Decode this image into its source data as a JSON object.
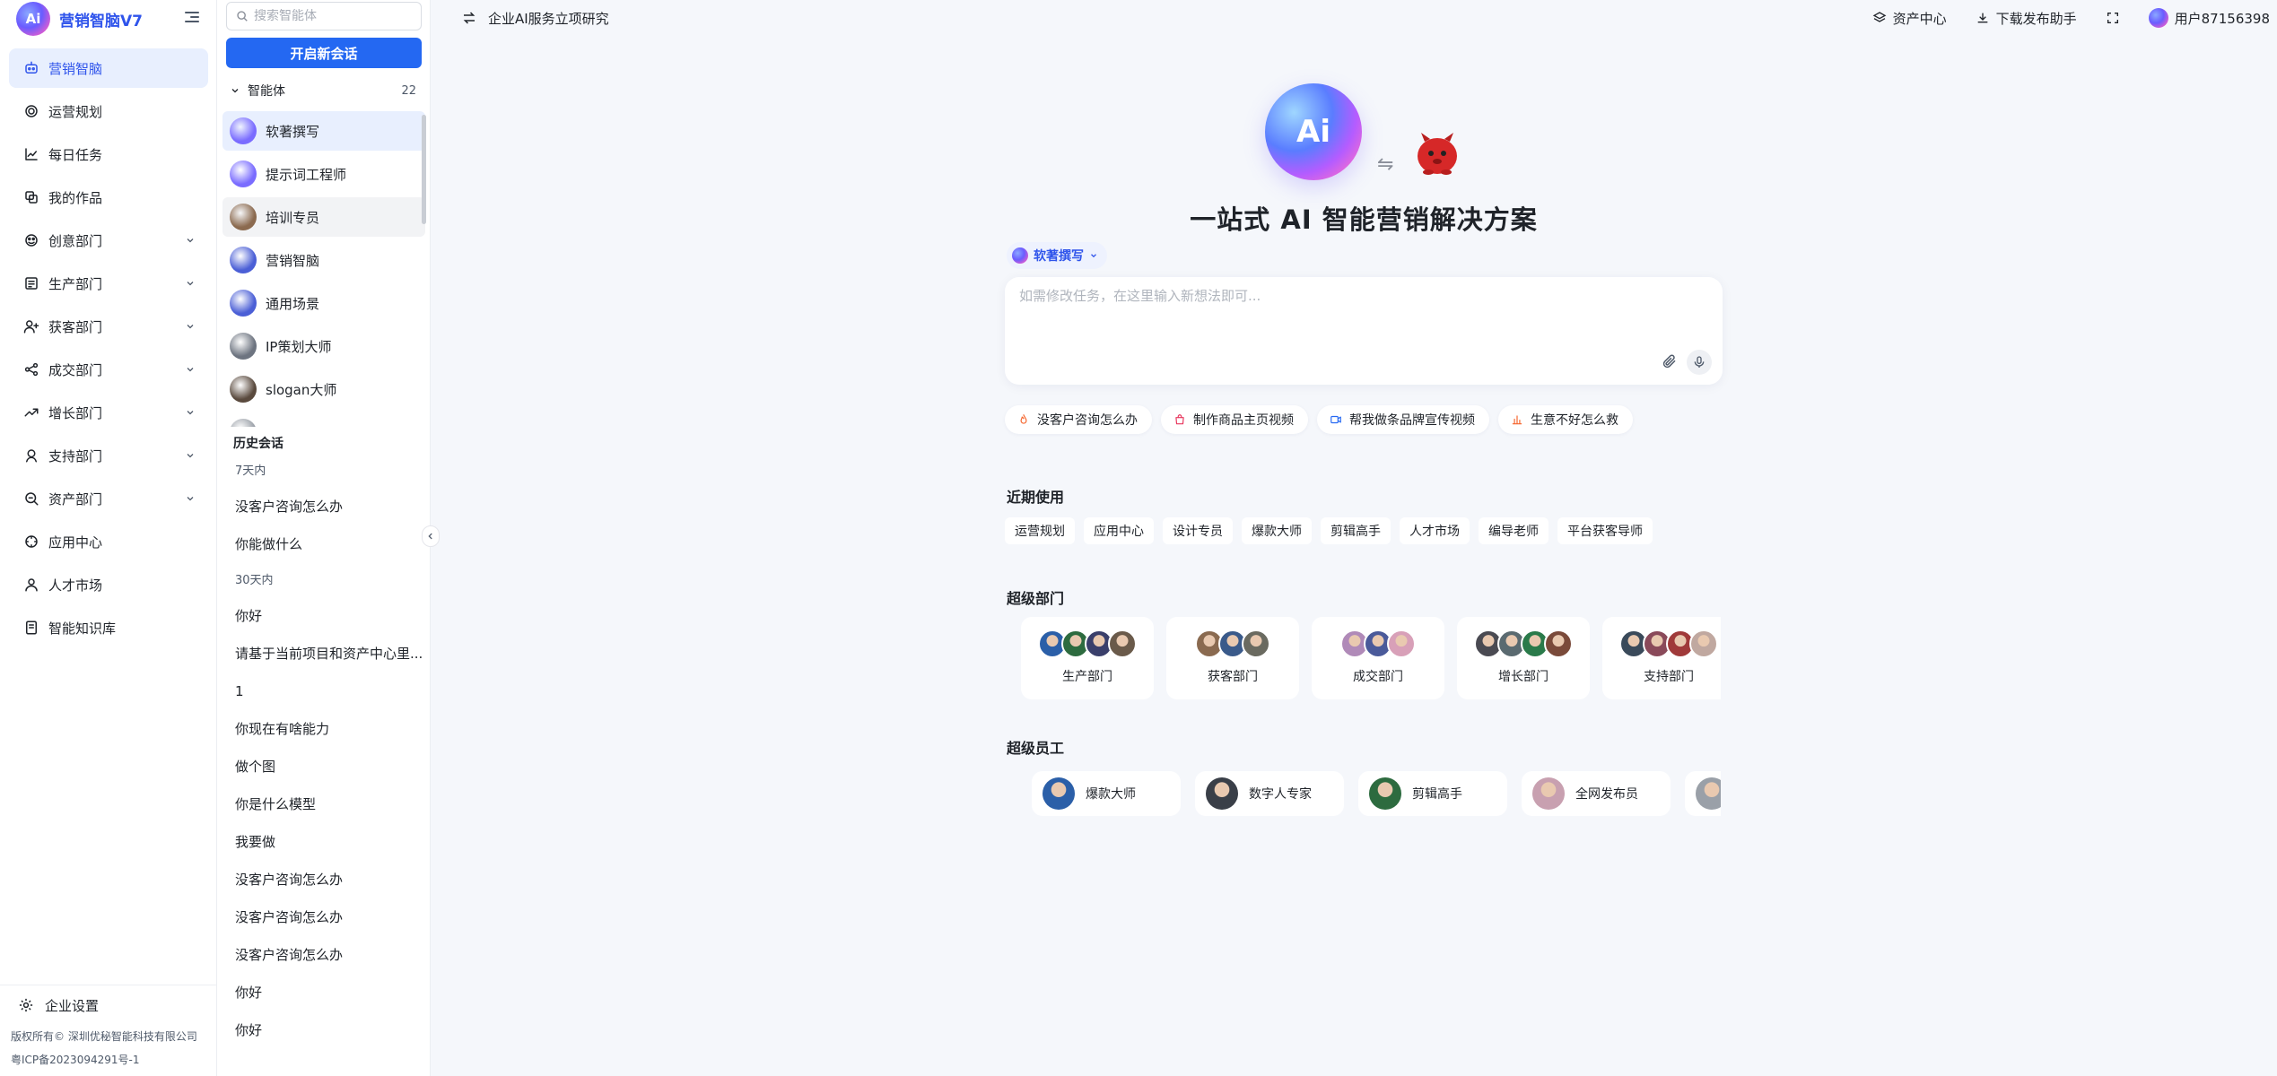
{
  "brand": {
    "name": "营销智脑V7"
  },
  "nav": {
    "items": [
      {
        "label": "营销智脑",
        "icon": "robot-icon",
        "active": true,
        "expandable": false
      },
      {
        "label": "运营规划",
        "icon": "target-icon",
        "expandable": false
      },
      {
        "label": "每日任务",
        "icon": "chart-line-icon",
        "expandable": false
      },
      {
        "label": "我的作品",
        "icon": "works-icon",
        "expandable": false
      },
      {
        "label": "创意部门",
        "icon": "palette-icon",
        "expandable": true
      },
      {
        "label": "生产部门",
        "icon": "factory-icon",
        "expandable": true
      },
      {
        "label": "获客部门",
        "icon": "user-add-icon",
        "expandable": true
      },
      {
        "label": "成交部门",
        "icon": "share-icon",
        "expandable": true
      },
      {
        "label": "增长部门",
        "icon": "trend-up-icon",
        "expandable": true
      },
      {
        "label": "支持部门",
        "icon": "support-icon",
        "expandable": true
      },
      {
        "label": "资产部门",
        "icon": "search-asset-icon",
        "expandable": true
      },
      {
        "label": "应用中心",
        "icon": "compass-icon",
        "expandable": false
      },
      {
        "label": "人才市场",
        "icon": "person-icon",
        "expandable": false
      },
      {
        "label": "智能知识库",
        "icon": "book-icon",
        "expandable": false
      }
    ],
    "settings_label": "企业设置",
    "copyright": "版权所有© 深圳优秘智能科技有限公司",
    "icp": "粤ICP备2023094291号-1"
  },
  "panel": {
    "search_placeholder": "搜索智能体",
    "new_chat_label": "开启新会话",
    "agents_label": "智能体",
    "agents_count": "22",
    "agents": [
      {
        "name": "软著撰写",
        "avatar": "#7a6cff",
        "active": true
      },
      {
        "name": "提示词工程师",
        "avatar": "#7a6cff"
      },
      {
        "name": "培训专员",
        "avatar": "#8b6a4f",
        "hover": true
      },
      {
        "name": "营销智脑",
        "avatar": "#4b5fd6"
      },
      {
        "name": "通用场景",
        "avatar": "#4b5fd6"
      },
      {
        "name": "IP策划大师",
        "avatar": "#6d7480"
      },
      {
        "name": "slogan大师",
        "avatar": "#5a4a3e"
      },
      {
        "name": "",
        "avatar": "#9aa0a8"
      }
    ],
    "history_label": "历史会话",
    "history": [
      {
        "group": "7天内",
        "items": [
          "没客户咨询怎么办",
          "你能做什么"
        ]
      },
      {
        "group": "30天内",
        "items": [
          "你好",
          "请基于当前项目和资产中心里...",
          "1",
          "你现在有啥能力",
          "做个图",
          "你是什么模型",
          "我要做",
          "没客户咨询怎么办",
          "没客户咨询怎么办",
          "没客户咨询怎么办",
          "你好",
          "你好"
        ]
      }
    ]
  },
  "topbar": {
    "project": "企业AI服务立项研究",
    "assets_label": "资产中心",
    "download_label": "下载发布助手",
    "user_label": "用户87156398"
  },
  "main": {
    "hero_logo_text": "Ai",
    "title": "一站式 AI 智能营销解决方案",
    "agent_pill": "软著撰写",
    "input_placeholder": "如需修改任务，在这里输入新想法即可...",
    "suggestions": [
      {
        "label": "没客户咨询怎么办",
        "icon": "fire-icon",
        "color": "#f5632a"
      },
      {
        "label": "制作商品主页视频",
        "icon": "bag-icon",
        "color": "#e8365d"
      },
      {
        "label": "帮我做条品牌宣传视频",
        "icon": "video-icon",
        "color": "#2468f2"
      },
      {
        "label": "生意不好怎么救",
        "icon": "bar-chart-icon",
        "color": "#f5632a"
      }
    ],
    "recent_label": "近期使用",
    "recent": [
      "运营规划",
      "应用中心",
      "设计专员",
      "爆款大师",
      "剪辑高手",
      "人才市场",
      "编导老师",
      "平台获客导师"
    ],
    "depts_label": "超级部门",
    "depts": [
      {
        "name": "生产部门",
        "faces": [
          "#2b5fa8",
          "#2d6b3f",
          "#3a3f6b",
          "#6a5a4a"
        ]
      },
      {
        "name": "获客部门",
        "faces": [
          "#8a6a50",
          "#3a5a8a",
          "#6a6a60"
        ]
      },
      {
        "name": "成交部门",
        "faces": [
          "#b08ab8",
          "#4a5a9a",
          "#d8a0b8"
        ]
      },
      {
        "name": "增长部门",
        "faces": [
          "#4a4a52",
          "#5a6a70",
          "#2a7a4a",
          "#7a4a3a"
        ]
      },
      {
        "name": "支持部门",
        "faces": [
          "#3a4a5a",
          "#8a4a5a",
          "#a03a3a",
          "#c0a8a0"
        ]
      }
    ],
    "employees_label": "超级员工",
    "employees": [
      {
        "name": "爆款大师",
        "face": "#2b5fa8"
      },
      {
        "name": "数字人专家",
        "face": "#3a3f48"
      },
      {
        "name": "剪辑高手",
        "face": "#2d6b3f"
      },
      {
        "name": "全网发布员",
        "face": "#c8a0b0"
      },
      {
        "name": "",
        "face": "#9aa0a8"
      }
    ]
  },
  "colors": {
    "primary": "#2468f2",
    "active_bg": "#e8effe",
    "page_bg": "#f5f7fb"
  }
}
